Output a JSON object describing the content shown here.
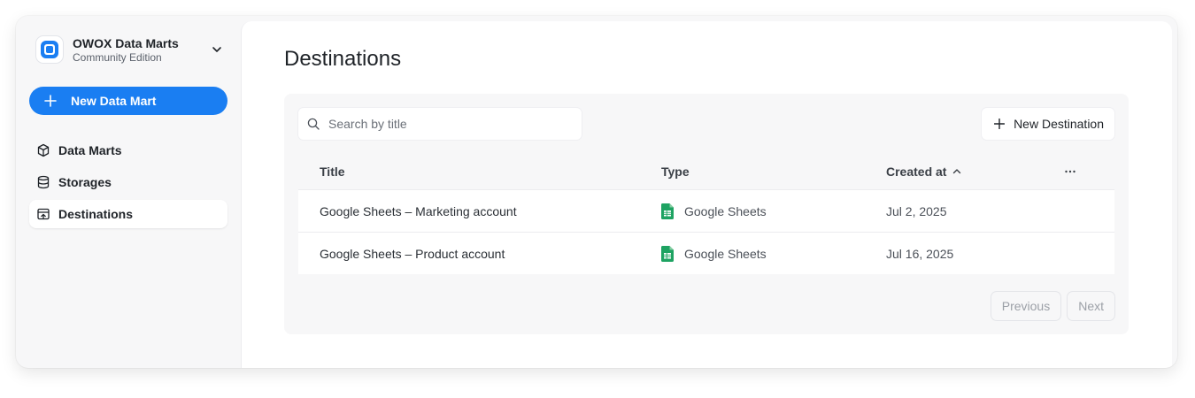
{
  "brand": {
    "name": "OWOX Data Marts",
    "edition": "Community Edition",
    "logo_icon": "owox-logo-icon",
    "accent": "#1a7ef2"
  },
  "sidebar": {
    "new_button_label": "New Data Mart",
    "items": [
      {
        "label": "Data Marts",
        "icon": "cube-icon",
        "active": false
      },
      {
        "label": "Storages",
        "icon": "database-icon",
        "active": false
      },
      {
        "label": "Destinations",
        "icon": "destination-icon",
        "active": true
      }
    ]
  },
  "main": {
    "title": "Destinations",
    "search": {
      "placeholder": "Search by title",
      "value": ""
    },
    "new_destination_label": "New Destination",
    "table": {
      "columns": {
        "title": "Title",
        "type": "Type",
        "created_at": "Created at"
      },
      "sort": {
        "column": "created_at",
        "direction": "ascending"
      },
      "rows": [
        {
          "title": "Google Sheets – Marketing account",
          "type": "Google Sheets",
          "type_icon": "google-sheets-icon",
          "created_at": "Jul 2, 2025"
        },
        {
          "title": "Google Sheets – Product account",
          "type": "Google Sheets",
          "type_icon": "google-sheets-icon",
          "created_at": "Jul 16, 2025"
        }
      ]
    },
    "pagination": {
      "previous_label": "Previous",
      "next_label": "Next"
    }
  }
}
